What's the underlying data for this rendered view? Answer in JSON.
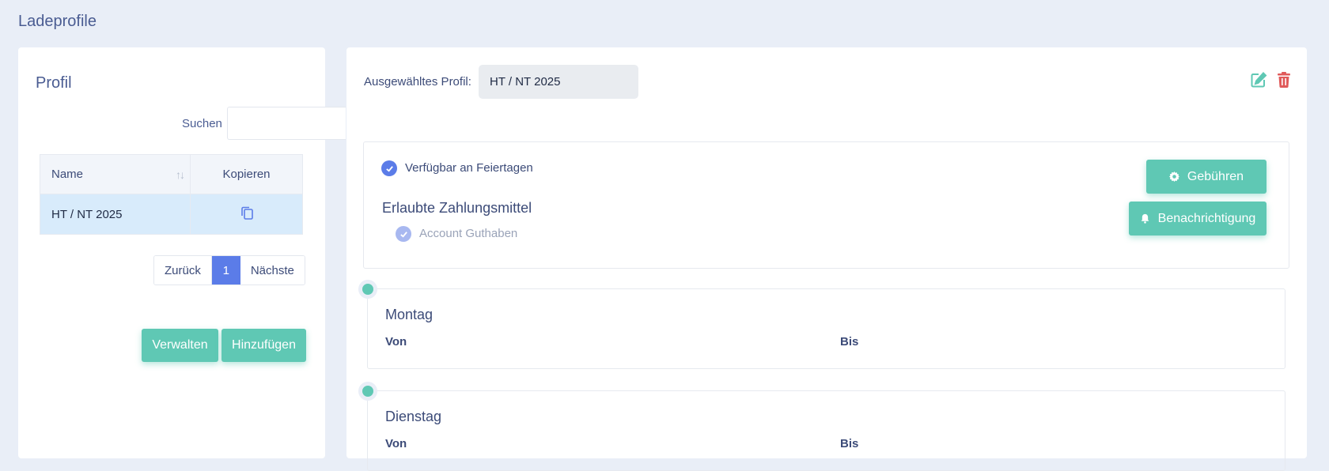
{
  "page_title": "Ladeprofile",
  "colors": {
    "accent": "#5b7ce8",
    "green": "#5fc8b4",
    "danger": "#e05a5a",
    "bg": "#e9eef7"
  },
  "profile_panel": {
    "title": "Profil",
    "search": {
      "label": "Suchen",
      "value": "",
      "placeholder": ""
    },
    "table": {
      "headers": {
        "name": "Name",
        "copy": "Kopieren"
      },
      "rows": [
        {
          "name": "HT / NT 2025",
          "copy_icon": "copy-icon"
        }
      ]
    },
    "pagination": {
      "prev": "Zurück",
      "current": "1",
      "next": "Nächste"
    },
    "buttons": {
      "manage": "Verwalten",
      "add": "Hinzufügen"
    }
  },
  "detail_panel": {
    "selected_label": "Ausgewähltes Profil:",
    "selected_value": "HT / NT 2025",
    "holidays_label": "Verfügbar an Feiertagen",
    "payment_title": "Erlaubte Zahlungsmittel",
    "payment_methods": [
      {
        "label": "Account Guthaben",
        "checked": true
      }
    ],
    "buttons": {
      "fees": "Gebühren",
      "notification": "Benachrichtigung"
    },
    "days": [
      {
        "name": "Montag",
        "from": "Von",
        "to": "Bis"
      },
      {
        "name": "Dienstag",
        "from": "Von",
        "to": "Bis"
      }
    ]
  }
}
